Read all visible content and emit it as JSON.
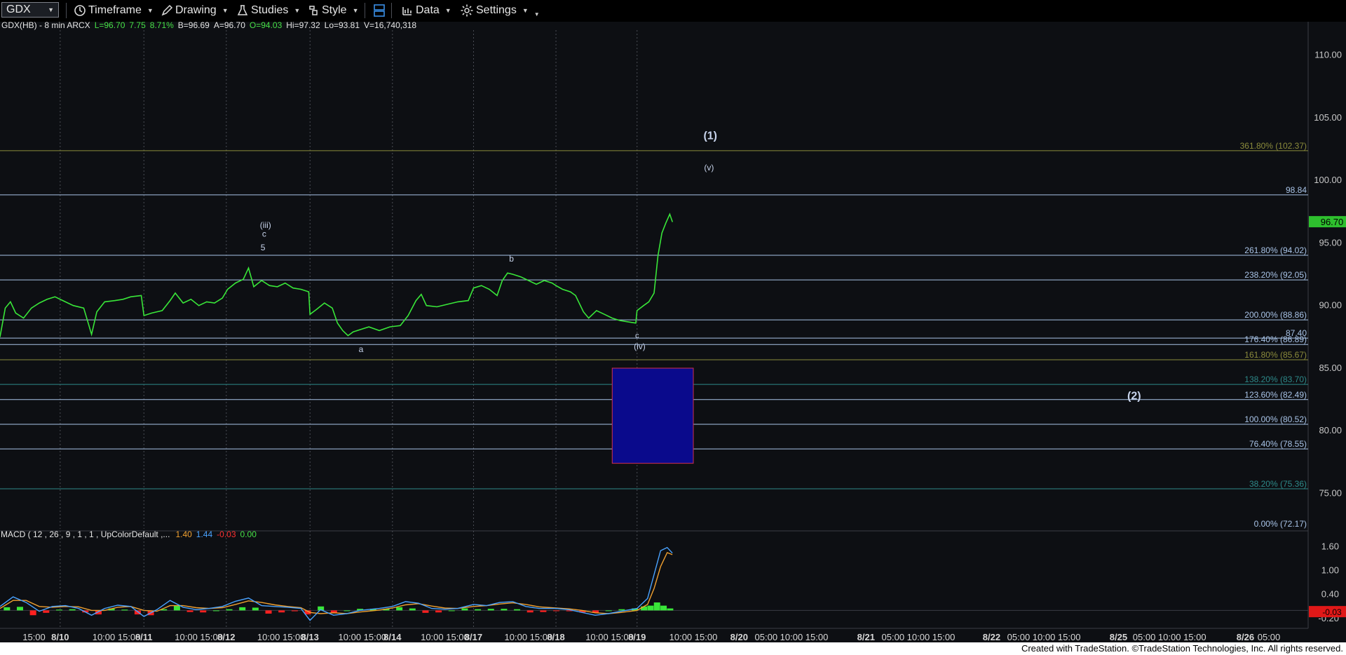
{
  "toolbar": {
    "symbol": "GDX",
    "timeframe": "Timeframe",
    "drawing": "Drawing",
    "studies": "Studies",
    "style": "Style",
    "data": "Data",
    "settings": "Settings"
  },
  "header": {
    "symbol_info": "GDX(HB) - 8 min  ARCX",
    "fields": [
      {
        "text": "L=96.70",
        "color": "#46e046"
      },
      {
        "text": "7.75",
        "color": "#46e046"
      },
      {
        "text": "8.71%",
        "color": "#46e046"
      },
      {
        "text": "B=96.69",
        "color": "#e6e6e6"
      },
      {
        "text": "A=96.70",
        "color": "#e6e6e6"
      },
      {
        "text": "O=94.03",
        "color": "#46e046"
      },
      {
        "text": "Hi=97.32",
        "color": "#e6e6e6"
      },
      {
        "text": "Lo=93.81",
        "color": "#e6e6e6"
      },
      {
        "text": "V=16,740,318",
        "color": "#e6e6e6"
      }
    ]
  },
  "macd_header": {
    "label": "MACD ( 12 , 26 , 9 , 1 , 1 , UpColorDefault ,...",
    "values": [
      {
        "text": "1.40",
        "color": "#f0a030"
      },
      {
        "text": "1.44",
        "color": "#4aa3ff"
      },
      {
        "text": "-0.03",
        "color": "#ff3030"
      },
      {
        "text": "0.00",
        "color": "#46e046"
      }
    ]
  },
  "colors": {
    "price": "#39e639",
    "fib_blue": "#a9c4e8",
    "fib_olive": "#8c8c3c",
    "fib_teal": "#2e8a8a",
    "box_fill": "#0a0a8c",
    "box_border": "#d03050",
    "macd_line": "#4aa3ff",
    "signal_line": "#f0a030",
    "hist_up": "#39e639",
    "hist_down": "#ff2020"
  },
  "footer": "Created with TradeStation. ©TradeStation Technologies, Inc. All rights reserved.",
  "chart_data": {
    "type": "line",
    "ylim": [
      72.17,
      112.0
    ],
    "y_ticks": [
      "110.00",
      "105.00",
      "100.00",
      "95.00",
      "90.00",
      "85.00",
      "80.00",
      "75.00"
    ],
    "last_price": "96.70",
    "x_ticks": [
      {
        "label": "15:00",
        "pos": 0.026
      },
      {
        "label": "8/10",
        "pos": 0.046
      },
      {
        "label": "10:00 15:00",
        "pos": 0.089
      },
      {
        "label": "8/11",
        "pos": 0.11
      },
      {
        "label": "10:00 15:00",
        "pos": 0.152
      },
      {
        "label": "8/12",
        "pos": 0.173
      },
      {
        "label": "10:00 15:00",
        "pos": 0.215
      },
      {
        "label": "8/13",
        "pos": 0.237
      },
      {
        "label": "10:00 15:00",
        "pos": 0.277
      },
      {
        "label": "8/14",
        "pos": 0.3
      },
      {
        "label": "10:00 15:00",
        "pos": 0.34
      },
      {
        "label": "8/17",
        "pos": 0.362
      },
      {
        "label": "10:00 15:00",
        "pos": 0.404
      },
      {
        "label": "8/18",
        "pos": 0.425
      },
      {
        "label": "10:00 15:00",
        "pos": 0.466
      },
      {
        "label": "8/19",
        "pos": 0.487
      },
      {
        "label": "10:00 15:00",
        "pos": 0.53
      },
      {
        "label": "8/20",
        "pos": 0.565
      },
      {
        "label": "05:00 10:00 15:00",
        "pos": 0.605
      },
      {
        "label": "8/21",
        "pos": 0.662
      },
      {
        "label": "05:00 10:00 15:00",
        "pos": 0.702
      },
      {
        "label": "8/22",
        "pos": 0.758
      },
      {
        "label": "05:00 10:00 15:00",
        "pos": 0.798
      },
      {
        "label": "8/25",
        "pos": 0.855
      },
      {
        "label": "05:00 10:00 15:00",
        "pos": 0.894
      },
      {
        "label": "8/26",
        "pos": 0.952
      },
      {
        "label": "05:00",
        "pos": 0.97
      }
    ],
    "price_series": [
      [
        0,
        87.5
      ],
      [
        0.004,
        89.8
      ],
      [
        0.008,
        90.3
      ],
      [
        0.012,
        89.4
      ],
      [
        0.018,
        89.0
      ],
      [
        0.024,
        89.8
      ],
      [
        0.03,
        90.2
      ],
      [
        0.036,
        90.5
      ],
      [
        0.042,
        90.7
      ],
      [
        0.048,
        90.4
      ],
      [
        0.056,
        90.0
      ],
      [
        0.064,
        89.8
      ],
      [
        0.068,
        88.4
      ],
      [
        0.07,
        87.7
      ],
      [
        0.074,
        89.5
      ],
      [
        0.08,
        90.3
      ],
      [
        0.088,
        90.4
      ],
      [
        0.094,
        90.5
      ],
      [
        0.1,
        90.7
      ],
      [
        0.108,
        90.8
      ],
      [
        0.11,
        89.2
      ],
      [
        0.116,
        89.4
      ],
      [
        0.124,
        89.6
      ],
      [
        0.13,
        90.4
      ],
      [
        0.134,
        91.0
      ],
      [
        0.14,
        90.2
      ],
      [
        0.146,
        90.5
      ],
      [
        0.152,
        90.0
      ],
      [
        0.158,
        90.3
      ],
      [
        0.164,
        90.2
      ],
      [
        0.17,
        90.6
      ],
      [
        0.174,
        91.3
      ],
      [
        0.18,
        91.8
      ],
      [
        0.186,
        92.1
      ],
      [
        0.19,
        93.0
      ],
      [
        0.194,
        91.5
      ],
      [
        0.2,
        92.0
      ],
      [
        0.206,
        91.6
      ],
      [
        0.212,
        91.5
      ],
      [
        0.218,
        91.8
      ],
      [
        0.224,
        91.4
      ],
      [
        0.23,
        91.3
      ],
      [
        0.236,
        91.1
      ],
      [
        0.237,
        89.3
      ],
      [
        0.242,
        89.7
      ],
      [
        0.248,
        90.2
      ],
      [
        0.254,
        89.8
      ],
      [
        0.258,
        88.6
      ],
      [
        0.262,
        88.0
      ],
      [
        0.266,
        87.6
      ],
      [
        0.27,
        87.9
      ],
      [
        0.276,
        88.1
      ],
      [
        0.282,
        88.3
      ],
      [
        0.29,
        88.0
      ],
      [
        0.298,
        88.3
      ],
      [
        0.306,
        88.4
      ],
      [
        0.312,
        89.2
      ],
      [
        0.318,
        90.4
      ],
      [
        0.322,
        90.9
      ],
      [
        0.326,
        90.0
      ],
      [
        0.334,
        89.9
      ],
      [
        0.342,
        90.1
      ],
      [
        0.35,
        90.3
      ],
      [
        0.358,
        90.4
      ],
      [
        0.362,
        91.4
      ],
      [
        0.368,
        91.6
      ],
      [
        0.374,
        91.3
      ],
      [
        0.38,
        90.8
      ],
      [
        0.384,
        92.0
      ],
      [
        0.388,
        92.6
      ],
      [
        0.392,
        92.5
      ],
      [
        0.398,
        92.3
      ],
      [
        0.404,
        92.0
      ],
      [
        0.41,
        91.7
      ],
      [
        0.416,
        92.0
      ],
      [
        0.422,
        91.8
      ],
      [
        0.425,
        91.6
      ],
      [
        0.43,
        91.3
      ],
      [
        0.436,
        91.1
      ],
      [
        0.44,
        90.8
      ],
      [
        0.446,
        89.5
      ],
      [
        0.45,
        89.0
      ],
      [
        0.456,
        89.6
      ],
      [
        0.462,
        89.3
      ],
      [
        0.468,
        89.0
      ],
      [
        0.474,
        88.8
      ],
      [
        0.48,
        88.7
      ],
      [
        0.486,
        88.6
      ],
      [
        0.487,
        89.6
      ],
      [
        0.492,
        90.0
      ],
      [
        0.496,
        90.3
      ],
      [
        0.5,
        91.0
      ],
      [
        0.503,
        94.0
      ],
      [
        0.506,
        95.8
      ],
      [
        0.509,
        96.6
      ],
      [
        0.512,
        97.3
      ],
      [
        0.514,
        96.7
      ]
    ],
    "levels": [
      {
        "price": 102.37,
        "label": "361.80% (102.37)",
        "style": "olive"
      },
      {
        "price": 98.84,
        "label": "98.84",
        "style": "blue"
      },
      {
        "price": 94.02,
        "label": "261.80% (94.02)",
        "style": "blue"
      },
      {
        "price": 92.05,
        "label": "238.20% (92.05)",
        "style": "blue"
      },
      {
        "price": 88.86,
        "label": "200.00% (88.86)",
        "style": "blue"
      },
      {
        "price": 87.4,
        "label": "87.40",
        "style": "blue"
      },
      {
        "price": 86.89,
        "label": "176.40% (86.89)",
        "style": "blue"
      },
      {
        "price": 85.67,
        "label": "161.80% (85.67)",
        "style": "olive"
      },
      {
        "price": 83.7,
        "label": "138.20% (83.70)",
        "style": "teal"
      },
      {
        "price": 82.49,
        "label": "123.60% (82.49)",
        "style": "blue"
      },
      {
        "price": 80.52,
        "label": "100.00% (80.52)",
        "style": "blue"
      },
      {
        "price": 78.55,
        "label": "76.40% (78.55)",
        "style": "blue"
      },
      {
        "price": 75.36,
        "label": "38.20% (75.36)",
        "style": "teal"
      },
      {
        "price": 72.17,
        "label": "0.00% (72.17)",
        "style": "blue"
      }
    ],
    "target_box": {
      "x0": 0.468,
      "x1": 0.53,
      "y_top": 85.0,
      "y_bottom": 77.4
    },
    "annotations": [
      {
        "text": "(1)",
        "pos": 0.543,
        "price": 103.3,
        "size": 16
      },
      {
        "text": "(v)",
        "pos": 0.542,
        "price": 100.8,
        "size": 12
      },
      {
        "text": "(iii)",
        "pos": 0.203,
        "price": 96.2,
        "size": 12
      },
      {
        "text": "c",
        "pos": 0.202,
        "price": 95.5,
        "size": 12
      },
      {
        "text": "5",
        "pos": 0.201,
        "price": 94.4,
        "size": 12
      },
      {
        "text": "b",
        "pos": 0.391,
        "price": 93.5,
        "size": 12
      },
      {
        "text": "a",
        "pos": 0.276,
        "price": 86.3,
        "size": 12
      },
      {
        "text": "c",
        "pos": 0.487,
        "price": 87.4,
        "size": 11
      },
      {
        "text": "(iv)",
        "pos": 0.489,
        "price": 86.5,
        "size": 12
      },
      {
        "text": "(2)",
        "pos": 0.867,
        "price": 82.5,
        "size": 16
      }
    ],
    "vgrid": [
      0.046,
      0.11,
      0.173,
      0.237,
      0.3,
      0.362,
      0.425,
      0.487
    ],
    "macd": {
      "ylim": [
        -0.45,
        1.75
      ],
      "y_ticks": [
        "1.60",
        "1.00",
        "0.40",
        "-0.20"
      ],
      "last_hist": "-0.03",
      "macd_series": [
        [
          0,
          0.1
        ],
        [
          0.01,
          0.34
        ],
        [
          0.02,
          0.2
        ],
        [
          0.03,
          -0.02
        ],
        [
          0.04,
          0.1
        ],
        [
          0.05,
          0.12
        ],
        [
          0.06,
          0.05
        ],
        [
          0.07,
          -0.12
        ],
        [
          0.08,
          0.05
        ],
        [
          0.09,
          0.13
        ],
        [
          0.1,
          0.1
        ],
        [
          0.11,
          -0.15
        ],
        [
          0.12,
          0.02
        ],
        [
          0.13,
          0.25
        ],
        [
          0.14,
          0.08
        ],
        [
          0.15,
          0.02
        ],
        [
          0.16,
          0.05
        ],
        [
          0.17,
          0.1
        ],
        [
          0.18,
          0.23
        ],
        [
          0.19,
          0.31
        ],
        [
          0.2,
          0.12
        ],
        [
          0.21,
          0.1
        ],
        [
          0.22,
          0.08
        ],
        [
          0.23,
          0.05
        ],
        [
          0.237,
          -0.25
        ],
        [
          0.245,
          0.02
        ],
        [
          0.255,
          -0.12
        ],
        [
          0.265,
          -0.08
        ],
        [
          0.275,
          0.0
        ],
        [
          0.29,
          0.05
        ],
        [
          0.3,
          0.1
        ],
        [
          0.31,
          0.22
        ],
        [
          0.32,
          0.18
        ],
        [
          0.33,
          0.05
        ],
        [
          0.34,
          0.03
        ],
        [
          0.35,
          0.05
        ],
        [
          0.362,
          0.15
        ],
        [
          0.372,
          0.12
        ],
        [
          0.382,
          0.2
        ],
        [
          0.392,
          0.22
        ],
        [
          0.402,
          0.1
        ],
        [
          0.412,
          0.05
        ],
        [
          0.425,
          0.05
        ],
        [
          0.435,
          0.02
        ],
        [
          0.445,
          -0.05
        ],
        [
          0.455,
          -0.12
        ],
        [
          0.465,
          -0.08
        ],
        [
          0.475,
          -0.02
        ],
        [
          0.487,
          0.05
        ],
        [
          0.495,
          0.3
        ],
        [
          0.5,
          0.9
        ],
        [
          0.505,
          1.5
        ],
        [
          0.51,
          1.58
        ],
        [
          0.514,
          1.44
        ]
      ],
      "signal_series": [
        [
          0,
          0.05
        ],
        [
          0.01,
          0.25
        ],
        [
          0.02,
          0.25
        ],
        [
          0.03,
          0.1
        ],
        [
          0.04,
          0.08
        ],
        [
          0.05,
          0.1
        ],
        [
          0.06,
          0.09
        ],
        [
          0.07,
          0.0
        ],
        [
          0.08,
          0.0
        ],
        [
          0.09,
          0.08
        ],
        [
          0.1,
          0.1
        ],
        [
          0.11,
          0.0
        ],
        [
          0.12,
          -0.02
        ],
        [
          0.13,
          0.12
        ],
        [
          0.14,
          0.12
        ],
        [
          0.15,
          0.07
        ],
        [
          0.16,
          0.05
        ],
        [
          0.17,
          0.07
        ],
        [
          0.18,
          0.15
        ],
        [
          0.19,
          0.24
        ],
        [
          0.2,
          0.2
        ],
        [
          0.21,
          0.14
        ],
        [
          0.22,
          0.1
        ],
        [
          0.23,
          0.07
        ],
        [
          0.237,
          -0.05
        ],
        [
          0.245,
          -0.08
        ],
        [
          0.255,
          -0.06
        ],
        [
          0.265,
          -0.08
        ],
        [
          0.275,
          -0.04
        ],
        [
          0.29,
          0.01
        ],
        [
          0.3,
          0.06
        ],
        [
          0.31,
          0.14
        ],
        [
          0.32,
          0.17
        ],
        [
          0.33,
          0.11
        ],
        [
          0.34,
          0.06
        ],
        [
          0.35,
          0.05
        ],
        [
          0.362,
          0.1
        ],
        [
          0.372,
          0.12
        ],
        [
          0.382,
          0.16
        ],
        [
          0.392,
          0.19
        ],
        [
          0.402,
          0.15
        ],
        [
          0.412,
          0.09
        ],
        [
          0.425,
          0.06
        ],
        [
          0.435,
          0.04
        ],
        [
          0.445,
          0.0
        ],
        [
          0.455,
          -0.06
        ],
        [
          0.465,
          -0.08
        ],
        [
          0.475,
          -0.05
        ],
        [
          0.487,
          0.0
        ],
        [
          0.495,
          0.15
        ],
        [
          0.5,
          0.55
        ],
        [
          0.505,
          1.1
        ],
        [
          0.51,
          1.45
        ],
        [
          0.514,
          1.4
        ]
      ],
      "histogram": [
        [
          0.005,
          0.08
        ],
        [
          0.015,
          0.09
        ],
        [
          0.025,
          -0.12
        ],
        [
          0.035,
          -0.06
        ],
        [
          0.045,
          0.02
        ],
        [
          0.055,
          0.03
        ],
        [
          0.065,
          -0.05
        ],
        [
          0.075,
          -0.1
        ],
        [
          0.085,
          0.05
        ],
        [
          0.095,
          0.02
        ],
        [
          0.105,
          -0.1
        ],
        [
          0.115,
          -0.12
        ],
        [
          0.125,
          0.03
        ],
        [
          0.135,
          0.12
        ],
        [
          0.145,
          -0.04
        ],
        [
          0.155,
          -0.05
        ],
        [
          0.165,
          0.0
        ],
        [
          0.175,
          0.03
        ],
        [
          0.185,
          0.08
        ],
        [
          0.195,
          0.07
        ],
        [
          0.205,
          -0.08
        ],
        [
          0.215,
          -0.05
        ],
        [
          0.225,
          -0.02
        ],
        [
          0.235,
          -0.1
        ],
        [
          0.245,
          0.1
        ],
        [
          0.255,
          -0.06
        ],
        [
          0.265,
          0.0
        ],
        [
          0.275,
          0.04
        ],
        [
          0.285,
          0.04
        ],
        [
          0.295,
          0.04
        ],
        [
          0.305,
          0.08
        ],
        [
          0.315,
          0.05
        ],
        [
          0.325,
          -0.06
        ],
        [
          0.335,
          -0.05
        ],
        [
          0.345,
          0.0
        ],
        [
          0.355,
          0.05
        ],
        [
          0.365,
          0.03
        ],
        [
          0.375,
          0.04
        ],
        [
          0.385,
          0.04
        ],
        [
          0.395,
          0.03
        ],
        [
          0.405,
          -0.05
        ],
        [
          0.415,
          -0.04
        ],
        [
          0.425,
          -0.01
        ],
        [
          0.435,
          -0.02
        ],
        [
          0.445,
          -0.05
        ],
        [
          0.455,
          -0.06
        ],
        [
          0.465,
          0.0
        ],
        [
          0.475,
          0.03
        ],
        [
          0.485,
          0.05
        ],
        [
          0.492,
          0.1
        ],
        [
          0.497,
          0.12
        ],
        [
          0.502,
          0.2
        ],
        [
          0.507,
          0.12
        ],
        [
          0.512,
          0.05
        ]
      ]
    }
  }
}
